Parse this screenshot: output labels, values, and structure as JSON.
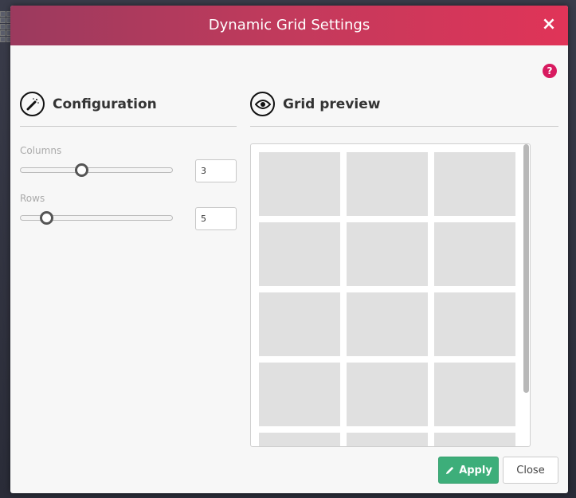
{
  "dialog": {
    "title": "Dynamic Grid Settings",
    "close_icon": "×",
    "help_icon": "?"
  },
  "configuration": {
    "title": "Configuration",
    "icon": "magic-wand-icon",
    "columns": {
      "label": "Columns",
      "value": "3",
      "slider_fraction": 0.4
    },
    "rows": {
      "label": "Rows",
      "value": "5",
      "slider_fraction": 0.17
    }
  },
  "preview": {
    "title": "Grid preview",
    "icon": "eye-icon",
    "columns": 3,
    "rows": 5
  },
  "footer": {
    "apply_label": "Apply",
    "close_label": "Close"
  },
  "colors": {
    "header_start": "#9b3a5e",
    "header_end": "#e03458",
    "apply": "#3dae7a",
    "help": "#d81b60"
  }
}
